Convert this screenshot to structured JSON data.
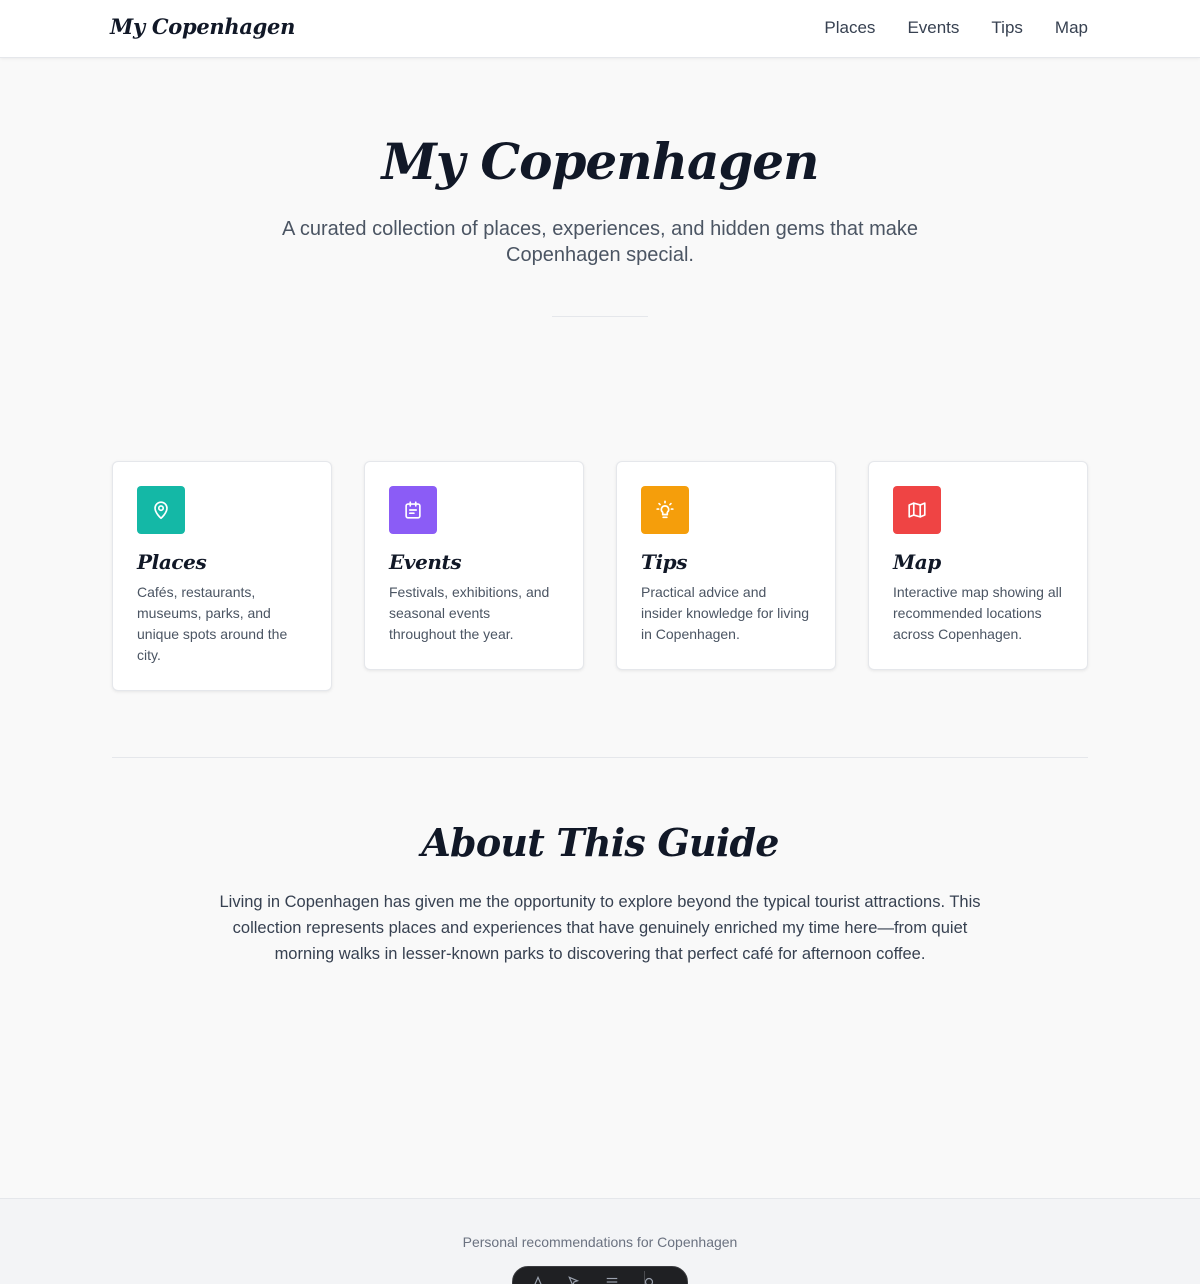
{
  "header": {
    "brand": "My Copenhagen",
    "nav": [
      "Places",
      "Events",
      "Tips",
      "Map"
    ]
  },
  "hero": {
    "title": "My Copenhagen",
    "subtitle": "A curated collection of places, experiences, and hidden gems that make Copenhagen special."
  },
  "cards": [
    {
      "title": "Places",
      "description": "Cafés, restaurants, museums, parks, and unique spots around the city.",
      "icon": "map-pin-icon",
      "color": "#14b8a6"
    },
    {
      "title": "Events",
      "description": "Festivals, exhibitions, and seasonal events throughout the year.",
      "icon": "calendar-icon",
      "color": "#8b5cf6"
    },
    {
      "title": "Tips",
      "description": "Practical advice and insider knowledge for living in Copenhagen.",
      "icon": "lightbulb-icon",
      "color": "#f59e0b"
    },
    {
      "title": "Map",
      "description": "Interactive map showing all recommended locations across Copenhagen.",
      "icon": "map-icon",
      "color": "#ef4444"
    }
  ],
  "about": {
    "title": "About This Guide",
    "text": "Living in Copenhagen has given me the opportunity to explore beyond the typical tourist attractions. This collection represents places and experiences that have genuinely enriched my time here—from quiet morning walks in lesser-known parks to discovering that perfect café for afternoon coffee."
  },
  "footer": {
    "text": "Personal recommendations for Copenhagen"
  },
  "colors": {
    "background": "#f9f9f9",
    "text": "#111827"
  }
}
